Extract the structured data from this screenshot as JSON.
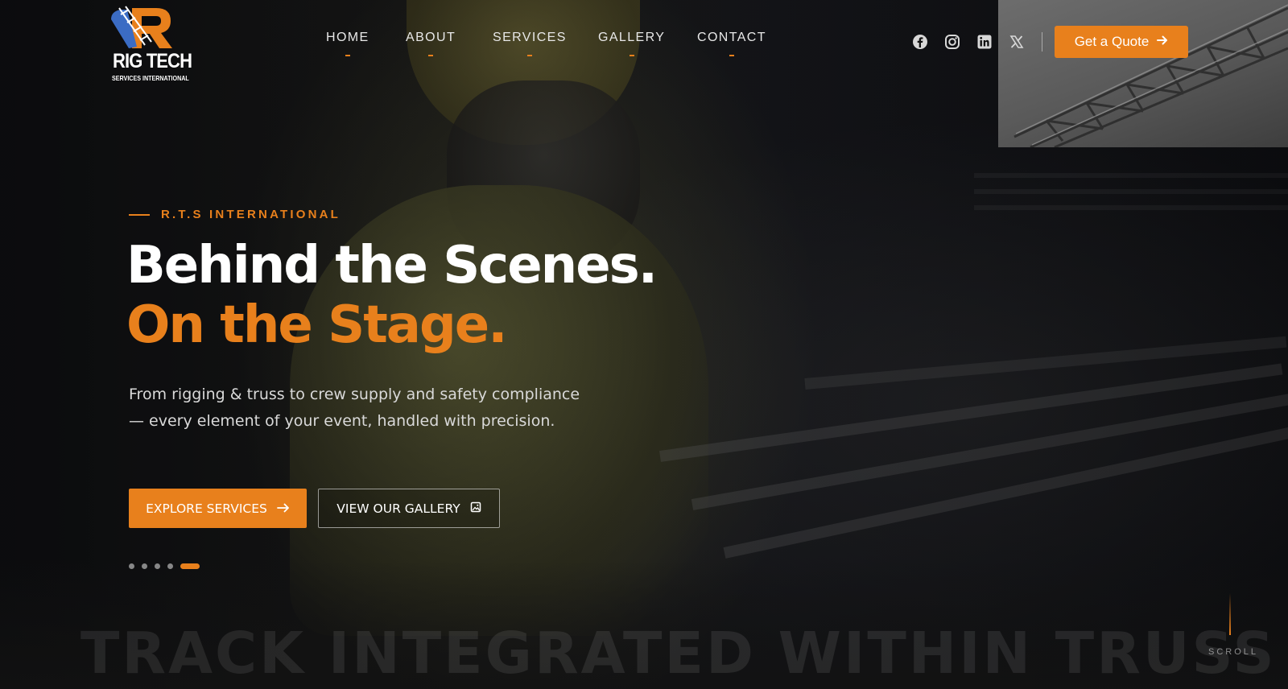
{
  "brand": {
    "name": "RIG TECH",
    "subtitle": "SERVICES INTERNATIONAL",
    "accent_color": "#e8801c"
  },
  "nav": {
    "items": [
      {
        "label": "HOME"
      },
      {
        "label": "ABOUT"
      },
      {
        "label": "SERVICES"
      },
      {
        "label": "GALLERY"
      },
      {
        "label": "CONTACT"
      }
    ]
  },
  "social": {
    "icons": [
      "facebook-icon",
      "instagram-icon",
      "linkedin-icon",
      "x-icon"
    ]
  },
  "header": {
    "quote_label": "Get a Quote",
    "quote_icon": "arrow-right-icon"
  },
  "hero": {
    "eyebrow": "R.T.S INTERNATIONAL",
    "title_line1": "Behind the Scenes.",
    "title_line2": "On the Stage.",
    "description": "From rigging & truss to crew supply and safety compliance — every element of your event, handled with precision.",
    "primary_button": "EXPLORE SERVICES",
    "primary_icon": "arrow-right-icon",
    "secondary_button": "VIEW OUR GALLERY",
    "secondary_icon": "image-icon",
    "slides_total": 5,
    "active_slide": 5
  },
  "marquee": {
    "text": "TRACK INTEGRATED WITHIN TRUSS"
  },
  "scroll": {
    "label": "SCROLL"
  }
}
